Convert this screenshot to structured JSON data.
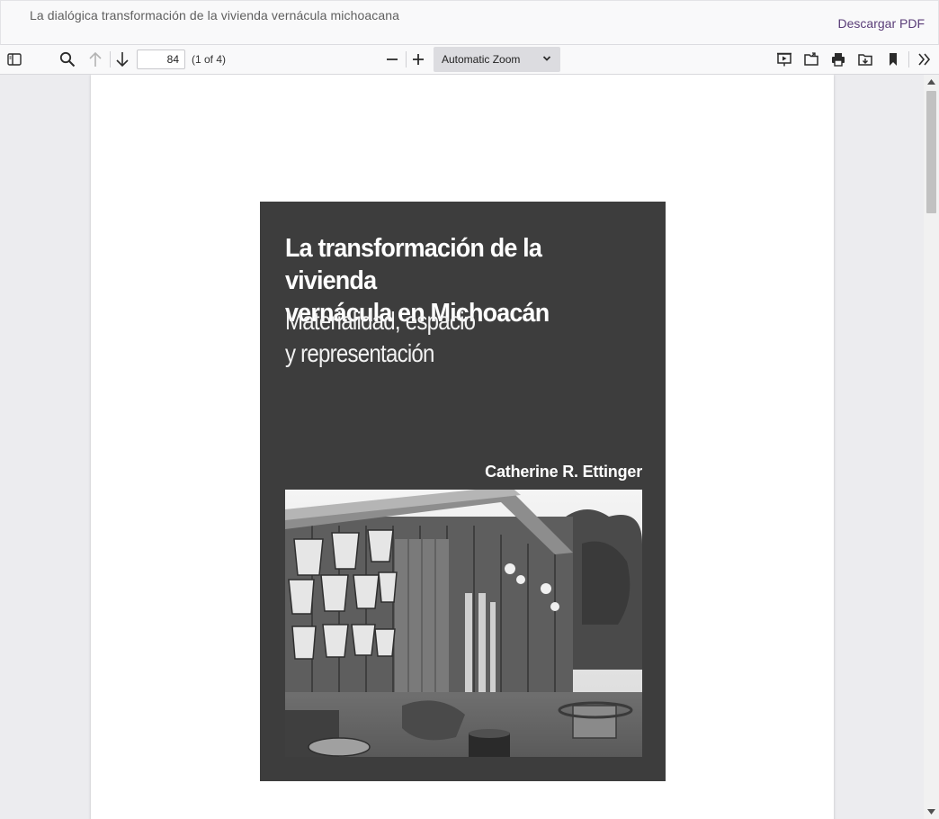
{
  "header": {
    "title": "La dialógica transformación de la vivienda vernácula michoacana",
    "download_label": "Descargar PDF"
  },
  "toolbar": {
    "page_number": "84",
    "page_count": "(1 of 4)",
    "zoom_label": "Automatic Zoom",
    "icons": [
      "sidebar-toggle-icon",
      "search-icon",
      "previous-page-icon",
      "next-page-icon",
      "zoom-out-icon",
      "zoom-in-icon",
      "presentation-mode-icon",
      "open-file-icon",
      "print-icon",
      "download-icon",
      "bookmark-icon",
      "tools-icon"
    ]
  },
  "document": {
    "cover": {
      "title_line1": "La transformación de la vivienda",
      "title_line2": "vernácula en Michoacán",
      "subtitle_line1": "Materialidad, espacio",
      "subtitle_line2": "y representación",
      "author": "Catherine R. Ettinger",
      "background": "#3d3d3d"
    }
  },
  "colors": {
    "download_link": "#5a3d78",
    "viewer_background": "#ececef",
    "toolbar_background": "#f9f9fa"
  }
}
